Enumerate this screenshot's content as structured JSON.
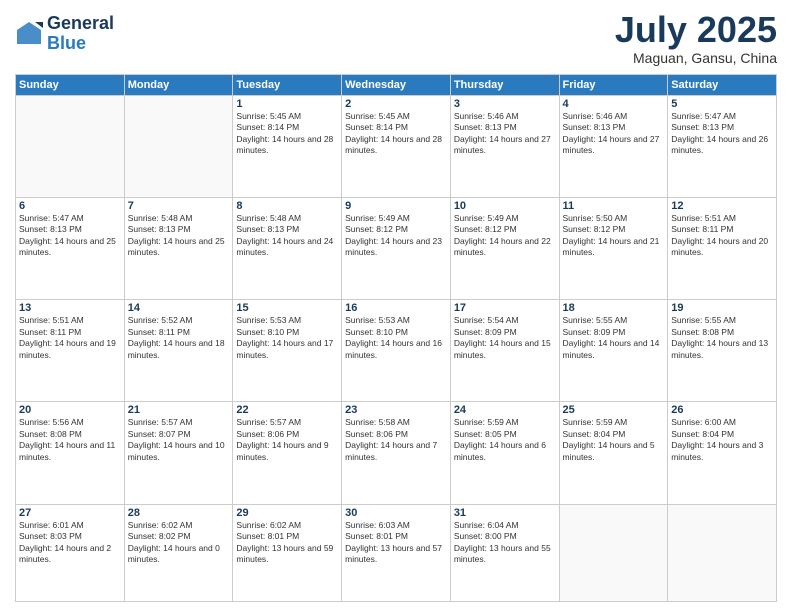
{
  "header": {
    "logo": {
      "general": "General",
      "blue": "Blue"
    },
    "title": "July 2025",
    "location": "Maguan, Gansu, China"
  },
  "weekdays": [
    "Sunday",
    "Monday",
    "Tuesday",
    "Wednesday",
    "Thursday",
    "Friday",
    "Saturday"
  ],
  "weeks": [
    [
      {
        "day": "",
        "content": ""
      },
      {
        "day": "",
        "content": ""
      },
      {
        "day": "1",
        "sunrise": "Sunrise: 5:45 AM",
        "sunset": "Sunset: 8:14 PM",
        "daylight": "Daylight: 14 hours and 28 minutes."
      },
      {
        "day": "2",
        "sunrise": "Sunrise: 5:45 AM",
        "sunset": "Sunset: 8:14 PM",
        "daylight": "Daylight: 14 hours and 28 minutes."
      },
      {
        "day": "3",
        "sunrise": "Sunrise: 5:46 AM",
        "sunset": "Sunset: 8:13 PM",
        "daylight": "Daylight: 14 hours and 27 minutes."
      },
      {
        "day": "4",
        "sunrise": "Sunrise: 5:46 AM",
        "sunset": "Sunset: 8:13 PM",
        "daylight": "Daylight: 14 hours and 27 minutes."
      },
      {
        "day": "5",
        "sunrise": "Sunrise: 5:47 AM",
        "sunset": "Sunset: 8:13 PM",
        "daylight": "Daylight: 14 hours and 26 minutes."
      }
    ],
    [
      {
        "day": "6",
        "sunrise": "Sunrise: 5:47 AM",
        "sunset": "Sunset: 8:13 PM",
        "daylight": "Daylight: 14 hours and 25 minutes."
      },
      {
        "day": "7",
        "sunrise": "Sunrise: 5:48 AM",
        "sunset": "Sunset: 8:13 PM",
        "daylight": "Daylight: 14 hours and 25 minutes."
      },
      {
        "day": "8",
        "sunrise": "Sunrise: 5:48 AM",
        "sunset": "Sunset: 8:13 PM",
        "daylight": "Daylight: 14 hours and 24 minutes."
      },
      {
        "day": "9",
        "sunrise": "Sunrise: 5:49 AM",
        "sunset": "Sunset: 8:12 PM",
        "daylight": "Daylight: 14 hours and 23 minutes."
      },
      {
        "day": "10",
        "sunrise": "Sunrise: 5:49 AM",
        "sunset": "Sunset: 8:12 PM",
        "daylight": "Daylight: 14 hours and 22 minutes."
      },
      {
        "day": "11",
        "sunrise": "Sunrise: 5:50 AM",
        "sunset": "Sunset: 8:12 PM",
        "daylight": "Daylight: 14 hours and 21 minutes."
      },
      {
        "day": "12",
        "sunrise": "Sunrise: 5:51 AM",
        "sunset": "Sunset: 8:11 PM",
        "daylight": "Daylight: 14 hours and 20 minutes."
      }
    ],
    [
      {
        "day": "13",
        "sunrise": "Sunrise: 5:51 AM",
        "sunset": "Sunset: 8:11 PM",
        "daylight": "Daylight: 14 hours and 19 minutes."
      },
      {
        "day": "14",
        "sunrise": "Sunrise: 5:52 AM",
        "sunset": "Sunset: 8:11 PM",
        "daylight": "Daylight: 14 hours and 18 minutes."
      },
      {
        "day": "15",
        "sunrise": "Sunrise: 5:53 AM",
        "sunset": "Sunset: 8:10 PM",
        "daylight": "Daylight: 14 hours and 17 minutes."
      },
      {
        "day": "16",
        "sunrise": "Sunrise: 5:53 AM",
        "sunset": "Sunset: 8:10 PM",
        "daylight": "Daylight: 14 hours and 16 minutes."
      },
      {
        "day": "17",
        "sunrise": "Sunrise: 5:54 AM",
        "sunset": "Sunset: 8:09 PM",
        "daylight": "Daylight: 14 hours and 15 minutes."
      },
      {
        "day": "18",
        "sunrise": "Sunrise: 5:55 AM",
        "sunset": "Sunset: 8:09 PM",
        "daylight": "Daylight: 14 hours and 14 minutes."
      },
      {
        "day": "19",
        "sunrise": "Sunrise: 5:55 AM",
        "sunset": "Sunset: 8:08 PM",
        "daylight": "Daylight: 14 hours and 13 minutes."
      }
    ],
    [
      {
        "day": "20",
        "sunrise": "Sunrise: 5:56 AM",
        "sunset": "Sunset: 8:08 PM",
        "daylight": "Daylight: 14 hours and 11 minutes."
      },
      {
        "day": "21",
        "sunrise": "Sunrise: 5:57 AM",
        "sunset": "Sunset: 8:07 PM",
        "daylight": "Daylight: 14 hours and 10 minutes."
      },
      {
        "day": "22",
        "sunrise": "Sunrise: 5:57 AM",
        "sunset": "Sunset: 8:06 PM",
        "daylight": "Daylight: 14 hours and 9 minutes."
      },
      {
        "day": "23",
        "sunrise": "Sunrise: 5:58 AM",
        "sunset": "Sunset: 8:06 PM",
        "daylight": "Daylight: 14 hours and 7 minutes."
      },
      {
        "day": "24",
        "sunrise": "Sunrise: 5:59 AM",
        "sunset": "Sunset: 8:05 PM",
        "daylight": "Daylight: 14 hours and 6 minutes."
      },
      {
        "day": "25",
        "sunrise": "Sunrise: 5:59 AM",
        "sunset": "Sunset: 8:04 PM",
        "daylight": "Daylight: 14 hours and 5 minutes."
      },
      {
        "day": "26",
        "sunrise": "Sunrise: 6:00 AM",
        "sunset": "Sunset: 8:04 PM",
        "daylight": "Daylight: 14 hours and 3 minutes."
      }
    ],
    [
      {
        "day": "27",
        "sunrise": "Sunrise: 6:01 AM",
        "sunset": "Sunset: 8:03 PM",
        "daylight": "Daylight: 14 hours and 2 minutes."
      },
      {
        "day": "28",
        "sunrise": "Sunrise: 6:02 AM",
        "sunset": "Sunset: 8:02 PM",
        "daylight": "Daylight: 14 hours and 0 minutes."
      },
      {
        "day": "29",
        "sunrise": "Sunrise: 6:02 AM",
        "sunset": "Sunset: 8:01 PM",
        "daylight": "Daylight: 13 hours and 59 minutes."
      },
      {
        "day": "30",
        "sunrise": "Sunrise: 6:03 AM",
        "sunset": "Sunset: 8:01 PM",
        "daylight": "Daylight: 13 hours and 57 minutes."
      },
      {
        "day": "31",
        "sunrise": "Sunrise: 6:04 AM",
        "sunset": "Sunset: 8:00 PM",
        "daylight": "Daylight: 13 hours and 55 minutes."
      },
      {
        "day": "",
        "content": ""
      },
      {
        "day": "",
        "content": ""
      }
    ]
  ]
}
